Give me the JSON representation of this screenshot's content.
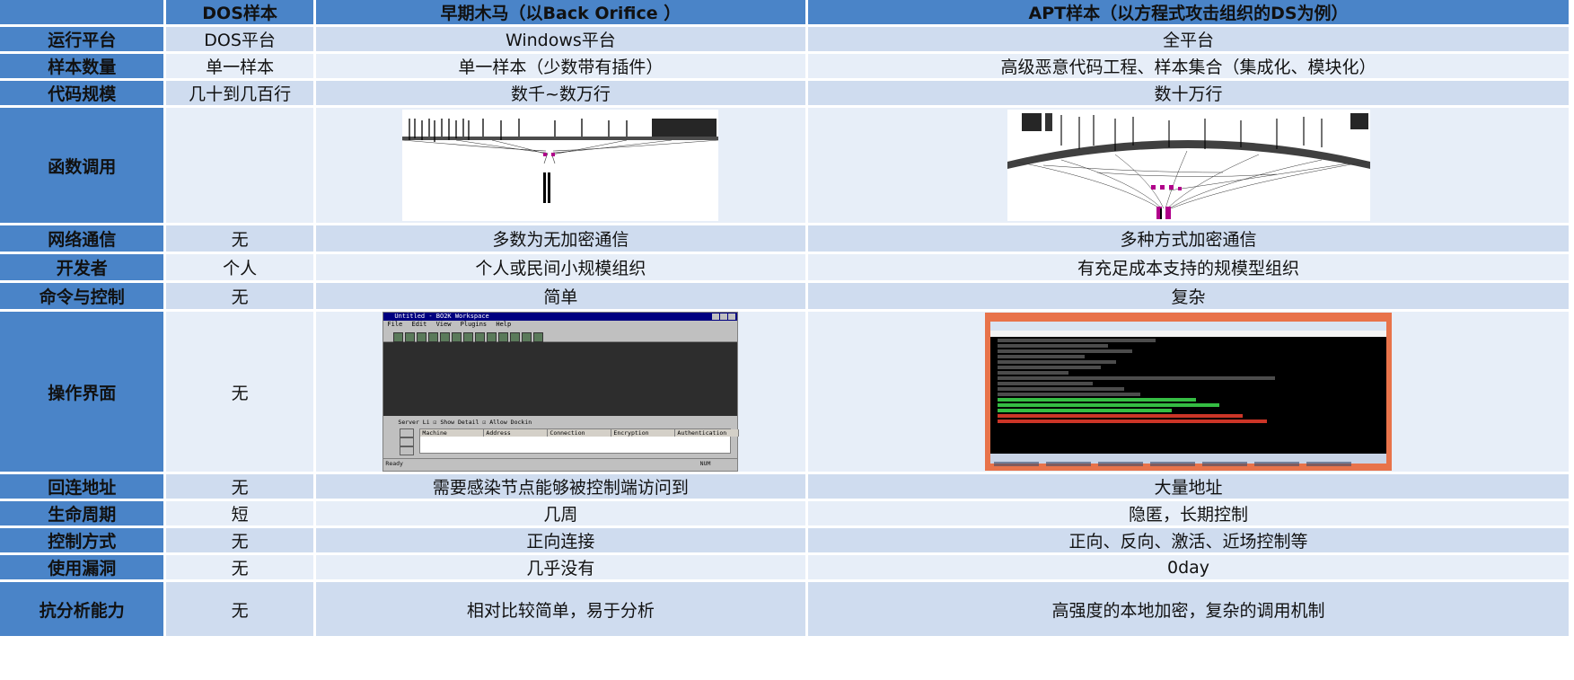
{
  "header": {
    "col1": "DOS样本",
    "col2": "早期木马（以Back Orifice ）",
    "col3": "APT样本（以方程式攻击组织的DS为例）"
  },
  "rows": [
    {
      "label": "运行平台",
      "c1": "DOS平台",
      "c2": "Windows平台",
      "c3": "全平台"
    },
    {
      "label": "样本数量",
      "c1": "单一样本",
      "c2": "单一样本（少数带有插件）",
      "c3": "高级恶意代码工程、样本集合（集成化、模块化）"
    },
    {
      "label": "代码规模",
      "c1": "几十到几百行",
      "c2": "数千~数万行",
      "c3": "数十万行"
    },
    {
      "label": "函数调用",
      "c1": "",
      "c2": "",
      "c3": ""
    },
    {
      "label": "网络通信",
      "c1": "无",
      "c2": "多数为无加密通信",
      "c3": "多种方式加密通信"
    },
    {
      "label": "开发者",
      "c1": "个人",
      "c2": "个人或民间小规模组织",
      "c3": "有充足成本支持的规模型组织"
    },
    {
      "label": "命令与控制",
      "c1": "无",
      "c2": "简单",
      "c3": "复杂"
    },
    {
      "label": "操作界面",
      "c1": "无",
      "c2": "",
      "c3": ""
    },
    {
      "label": "回连地址",
      "c1": "无",
      "c2": "需要感染节点能够被控制端访问到",
      "c3": "大量地址"
    },
    {
      "label": "生命周期",
      "c1": "短",
      "c2": "几周",
      "c3": "隐匿，长期控制"
    },
    {
      "label": "控制方式",
      "c1": "无",
      "c2": "正向连接",
      "c3": "正向、反向、激活、近场控制等"
    },
    {
      "label": "使用漏洞",
      "c1": "无",
      "c2": "几乎没有",
      "c3": "0day"
    },
    {
      "label": "抗分析能力",
      "c1": "无",
      "c2": "相对比较简单，易于分析",
      "c3": "高强度的本地加密，复杂的调用机制"
    }
  ],
  "bo2k": {
    "title": "Untitled - BO2K Workspace",
    "menu": [
      "File",
      "Edit",
      "View",
      "Plugins",
      "Help"
    ],
    "server_list": "Server Li",
    "show_details": "Show Detail",
    "allow_docking": "Allow Dockin",
    "columns": [
      "Machine",
      "Address",
      "Connection",
      "Encryption",
      "Authentication"
    ],
    "status": "Ready",
    "num": "NUM"
  },
  "colors": {
    "header": "#4a84c8",
    "row_odd": "#cfdcef",
    "row_even": "#e7eef8"
  }
}
